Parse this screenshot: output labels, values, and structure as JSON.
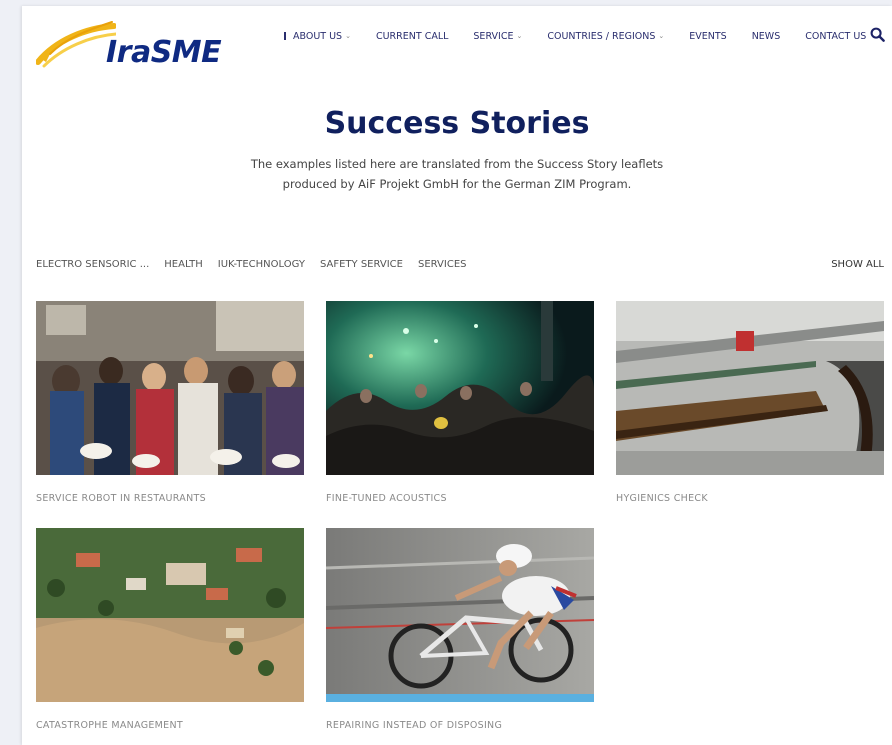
{
  "brand": {
    "name": "IraSME"
  },
  "nav": {
    "items": [
      {
        "label": "ABOUT US",
        "dropdown": true,
        "active": true
      },
      {
        "label": "CURRENT CALL",
        "dropdown": false
      },
      {
        "label": "SERVICE",
        "dropdown": true
      },
      {
        "label": "COUNTRIES / REGIONS",
        "dropdown": true
      },
      {
        "label": "EVENTS",
        "dropdown": false
      },
      {
        "label": "NEWS",
        "dropdown": false
      },
      {
        "label": "CONTACT US",
        "dropdown": false
      }
    ],
    "search_icon": "search-icon"
  },
  "hero": {
    "title": "Success Stories",
    "subtitle_line1": "The examples listed here are translated from the Success Story leaflets",
    "subtitle_line2": "produced by AiF Projekt GmbH for the German ZIM Program."
  },
  "filters": {
    "items": [
      "ELECTRO SENSORIC ...",
      "HEALTH",
      "IUK-TECHNOLOGY",
      "SAFETY SERVICE",
      "SERVICES"
    ],
    "show_all": "SHOW ALL"
  },
  "cards": [
    {
      "caption": "SERVICE ROBOT IN RESTAURANTS"
    },
    {
      "caption": "FINE-TUNED ACOUSTICS"
    },
    {
      "caption": "HYGIENICS CHECK"
    },
    {
      "caption": "CATASTROPHE MANAGEMENT"
    },
    {
      "caption": "REPAIRING INSTEAD OF DISPOSING"
    }
  ],
  "colors": {
    "brand_navy": "#0f2a82",
    "logo_gold": "#f0b418",
    "title_navy": "#10205e",
    "caption_gray": "#8a8a8a"
  }
}
